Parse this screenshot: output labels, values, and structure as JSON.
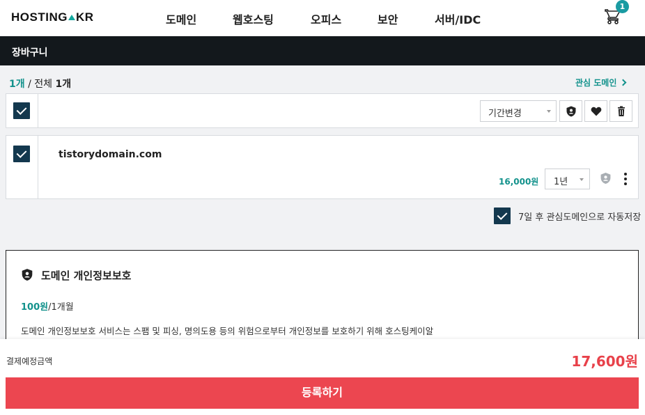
{
  "nav": {
    "logo": "HOSTING",
    "logo_suffix": "KR",
    "items": [
      "도메인",
      "웹호스팅",
      "오피스",
      "보안",
      "서버/IDC"
    ],
    "cart_count": "1"
  },
  "page_title": "장바구니",
  "counts": {
    "selected": "1개",
    "separator": " / 전체 ",
    "total": "1개"
  },
  "interest_link": "관심 도메인",
  "toolbar": {
    "period_select": "기간변경"
  },
  "cart_item": {
    "domain": "tistorydomain.com",
    "price": "16,000원",
    "period": "1년"
  },
  "autosave": {
    "label": "7일 후 관심도메인으로 자동저장",
    "checked": true
  },
  "privacy": {
    "title": "도메인 개인정보보호",
    "price": "100원",
    "period": "/1개월",
    "description": "도메인 개인정보보호 서비스는 스팸 및 피싱, 명의도용 등의 위험으로부터 개인정보를 보호하기 위해 호스팅케이알"
  },
  "summary": {
    "label": "결제예정금액",
    "amount": "17,600원"
  },
  "register_button": "등록하기",
  "colors": {
    "accent": "#13928c",
    "dark": "#13181c",
    "checkbox": "#13384e",
    "primary_button": "#ec4650",
    "total": "#e8414a"
  }
}
